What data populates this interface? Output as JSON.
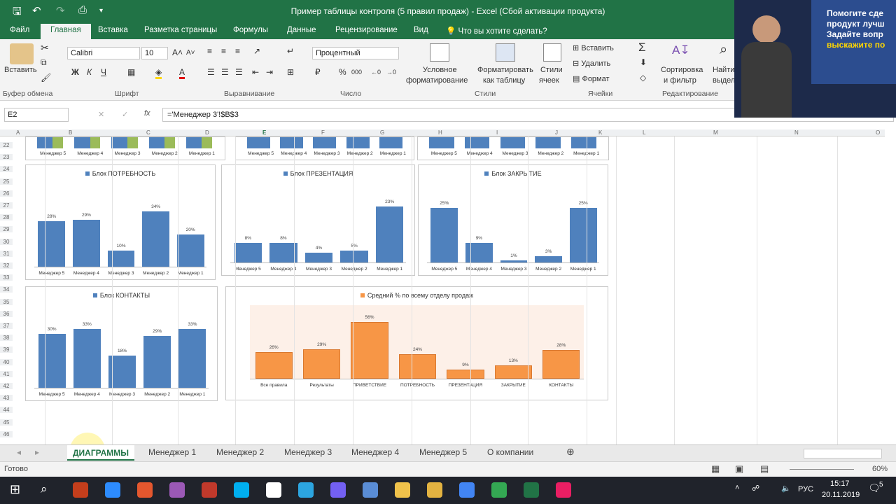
{
  "window": {
    "title": "Пример таблицы контроля (5 правил продаж) - Excel (Сбой активации продукта)"
  },
  "ribbon_tabs": [
    "Файл",
    "Главная",
    "Вставка",
    "Разметка страницы",
    "Формулы",
    "Данные",
    "Рецензирование",
    "Вид"
  ],
  "ribbon_tab_active": "Главная",
  "tell_me": "Что вы хотите сделать?",
  "ribbon": {
    "paste": "Вставить",
    "clipboard": "Буфер обмена",
    "font_name": "Calibri",
    "font_size": "10",
    "font_group": "Шрифт",
    "bold": "Ж",
    "italic": "К",
    "underline": "Ч",
    "align_group": "Выравнивание",
    "number_format": "Процентный",
    "number_group": "Число",
    "cond_format_1": "Условное",
    "cond_format_2": "форматирование",
    "format_table_1": "Форматировать",
    "format_table_2": "как таблицу",
    "cell_styles_1": "Стили",
    "cell_styles_2": "ячеек",
    "styles_group": "Стили",
    "insert": "Вставить",
    "delete": "Удалить",
    "format": "Формат",
    "cells_group": "Ячейки",
    "sort_1": "Сортировка",
    "sort_2": "и фильтр",
    "find_1": "Найти",
    "find_2": "выдели",
    "editing_group": "Редактирование"
  },
  "formula_bar": {
    "name_box": "E2",
    "formula": "='Менеджер 3'!$B$3"
  },
  "columns": [
    "A",
    "B",
    "C",
    "D",
    "E",
    "F",
    "G",
    "H",
    "I",
    "J",
    "K",
    "L",
    "M",
    "N",
    "O"
  ],
  "rows": [
    "22",
    "23",
    "24",
    "25",
    "26",
    "27",
    "28",
    "29",
    "30",
    "31",
    "32",
    "33",
    "34",
    "35",
    "36",
    "37",
    "38",
    "39",
    "40",
    "41",
    "42",
    "43",
    "44",
    "45",
    "46"
  ],
  "managers": [
    "Менеджер 5",
    "Менеджер 4",
    "Менеджер 3",
    "Менеджер 2",
    "Менеджер 1"
  ],
  "chart_data": [
    {
      "type": "bar",
      "title": "Блок ПОТРЕБНОСТЬ",
      "categories": [
        "Менеджер 5",
        "Менеджер 4",
        "Менеджер 3",
        "Менеджер 2",
        "Менеджер 1"
      ],
      "values": [
        28,
        29,
        10,
        34,
        20
      ],
      "labels": [
        "28%",
        "29%",
        "10%",
        "34%",
        "20%"
      ],
      "color": "#4f81bd"
    },
    {
      "type": "bar",
      "title": "Блок ПРЕЗЕНТАЦИЯ",
      "categories": [
        "Менеджер 5",
        "Менеджер 4",
        "Менеджер 3",
        "Менеджер 2",
        "Менеджер 1"
      ],
      "values": [
        8,
        8,
        4,
        5,
        23
      ],
      "labels": [
        "8%",
        "8%",
        "4%",
        "5%",
        "23%"
      ],
      "color": "#4f81bd"
    },
    {
      "type": "bar",
      "title": "Блок ЗАКРЫТИЕ",
      "categories": [
        "Менеджер 5",
        "Менеджер 4",
        "Менеджер 3",
        "Менеджер 2",
        "Менеджер 1"
      ],
      "values": [
        25,
        9,
        1,
        3,
        25
      ],
      "labels": [
        "25%",
        "9%",
        "1%",
        "3%",
        "25%"
      ],
      "color": "#4f81bd"
    },
    {
      "type": "bar",
      "title": "Блок КОНТАКТЫ",
      "categories": [
        "Менеджер 5",
        "Менеджер 4",
        "Менеджер 3",
        "Менеджер 2",
        "Менеджер 1"
      ],
      "values": [
        30,
        33,
        18,
        29,
        33
      ],
      "labels": [
        "30%",
        "33%",
        "18%",
        "29%",
        "33%"
      ],
      "color": "#4f81bd"
    },
    {
      "type": "bar",
      "title": "Средний % по всему отделу продаж",
      "categories": [
        "Все правила",
        "Результаты",
        "ПРИВЕТСТВИЕ",
        "ПОТРЕБНОСТЬ",
        "ПРЕЗЕНТАЦИЯ",
        "ЗАКРЫТИЕ",
        "КОНТАКТЫ"
      ],
      "values": [
        26,
        29,
        56,
        24,
        9,
        13,
        28
      ],
      "labels": [
        "26%",
        "29%",
        "56%",
        "24%",
        "9%",
        "13%",
        "28%"
      ],
      "color": "#f79646"
    }
  ],
  "sheet_tabs": [
    "ДИАГРАММЫ",
    "Менеджер 1",
    "Менеджер 2",
    "Менеджер 3",
    "Менеджер 4",
    "Менеджер 5",
    "О компании"
  ],
  "status": {
    "ready": "Готово",
    "zoom": "60%"
  },
  "taskbar": {
    "time": "15:17",
    "date": "20.11.2019",
    "lang": "РУС",
    "notif": "5"
  },
  "video_overlay": {
    "l1": "Помогите сде",
    "l2": "продукт лучш",
    "l3": "Задайте вопр",
    "l4": "выскажите по"
  }
}
